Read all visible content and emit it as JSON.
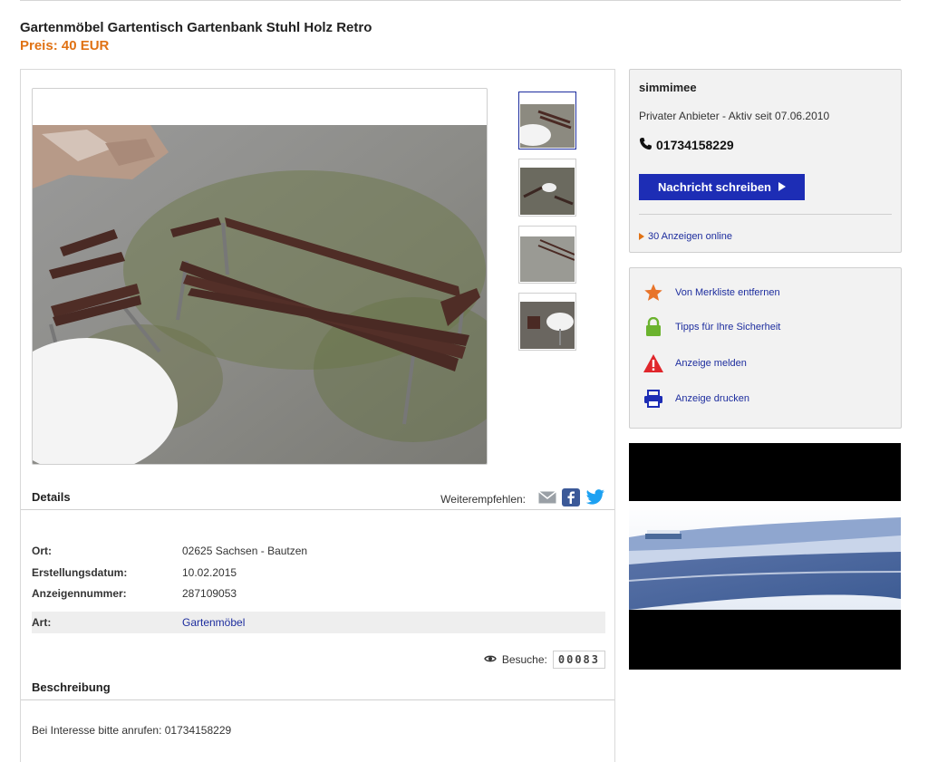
{
  "listing": {
    "title": "Gartenmöbel Gartentisch Gartenbank Stuhl Holz Retro",
    "price": "Preis: 40 EUR"
  },
  "details": {
    "heading": "Details",
    "share_label": "Weiterempfehlen:",
    "rows": [
      {
        "key": "Ort:",
        "value": "02625 Sachsen - Bautzen"
      },
      {
        "key": "Erstellungsdatum:",
        "value": "10.02.2015"
      },
      {
        "key": "Anzeigennummer:",
        "value": "287109053"
      },
      {
        "key": "Art:",
        "value": "Gartenmöbel"
      }
    ],
    "visits_label": "Besuche:",
    "visits_count": "00083"
  },
  "description": {
    "heading": "Beschreibung",
    "text": "Bei Interesse bitte anrufen: 01734158229"
  },
  "seller": {
    "name": "simmimee",
    "since": "Privater Anbieter - Aktiv seit 07.06.2010",
    "phone": "01734158229",
    "message_button": "Nachricht schreiben",
    "ads_online": "30 Anzeigen online"
  },
  "tools": [
    {
      "label": "Von Merkliste entfernen",
      "icon": "star-icon"
    },
    {
      "label": "Tipps für Ihre Sicherheit",
      "icon": "lock-icon"
    },
    {
      "label": "Anzeige melden",
      "icon": "warning-icon"
    },
    {
      "label": "Anzeige drucken",
      "icon": "printer-icon"
    }
  ],
  "colors": {
    "accent_orange": "#e07214",
    "link_blue": "#1d2d9e",
    "button_blue": "#1d2db5"
  }
}
